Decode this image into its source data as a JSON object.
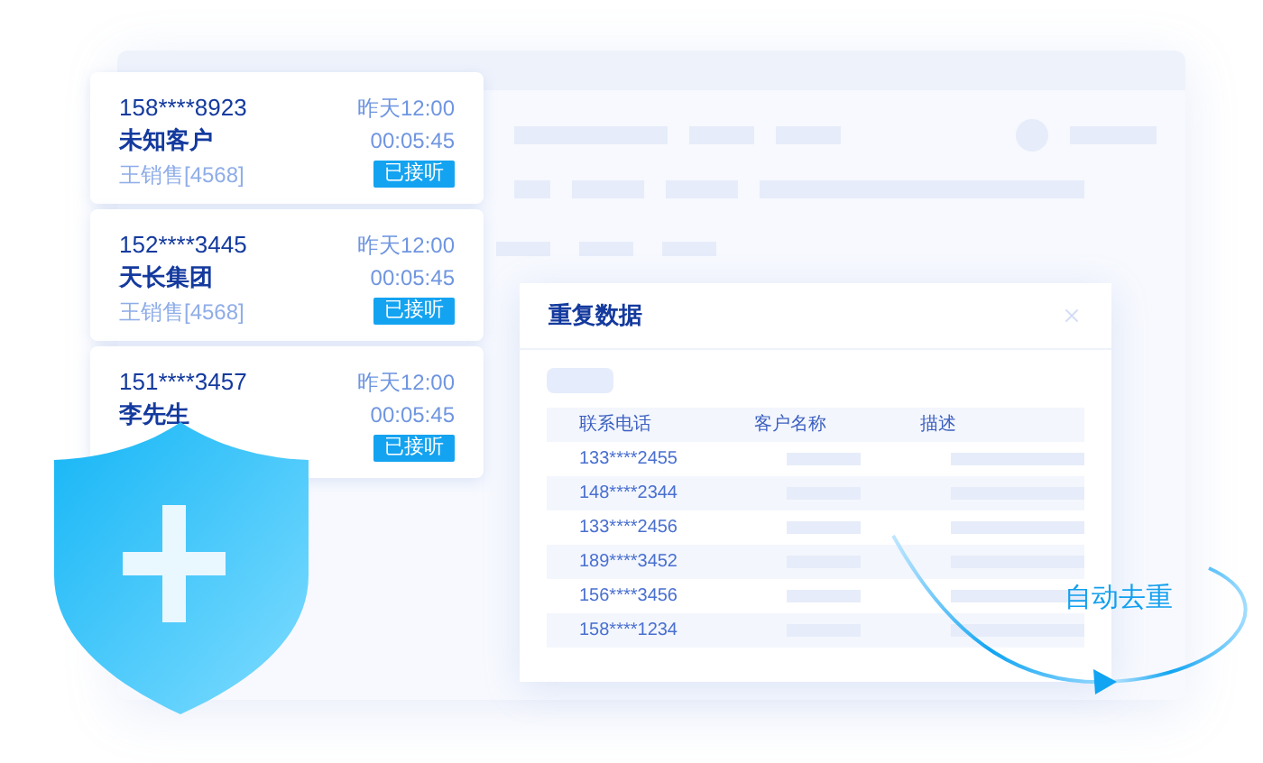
{
  "calls": [
    {
      "phone": "158****8923",
      "time": "昨天12:00",
      "name": "未知客户",
      "duration": "00:05:45",
      "agent": "王销售[4568]",
      "status": "已接听"
    },
    {
      "phone": "152****3445",
      "time": "昨天12:00",
      "name": "天长集团",
      "duration": "00:05:45",
      "agent": "王销售[4568]",
      "status": "已接听"
    },
    {
      "phone": "151****3457",
      "time": "昨天12:00",
      "name": "李先生",
      "duration": "00:05:45",
      "status": "已接听"
    }
  ],
  "dialog": {
    "title": "重复数据",
    "columns": [
      "联系电话",
      "客户名称",
      "描述"
    ],
    "rows": [
      "133****2455",
      "148****2344",
      "133****2456",
      "189****3452",
      "156****3456",
      "158****1234"
    ]
  },
  "caption": "自动去重"
}
